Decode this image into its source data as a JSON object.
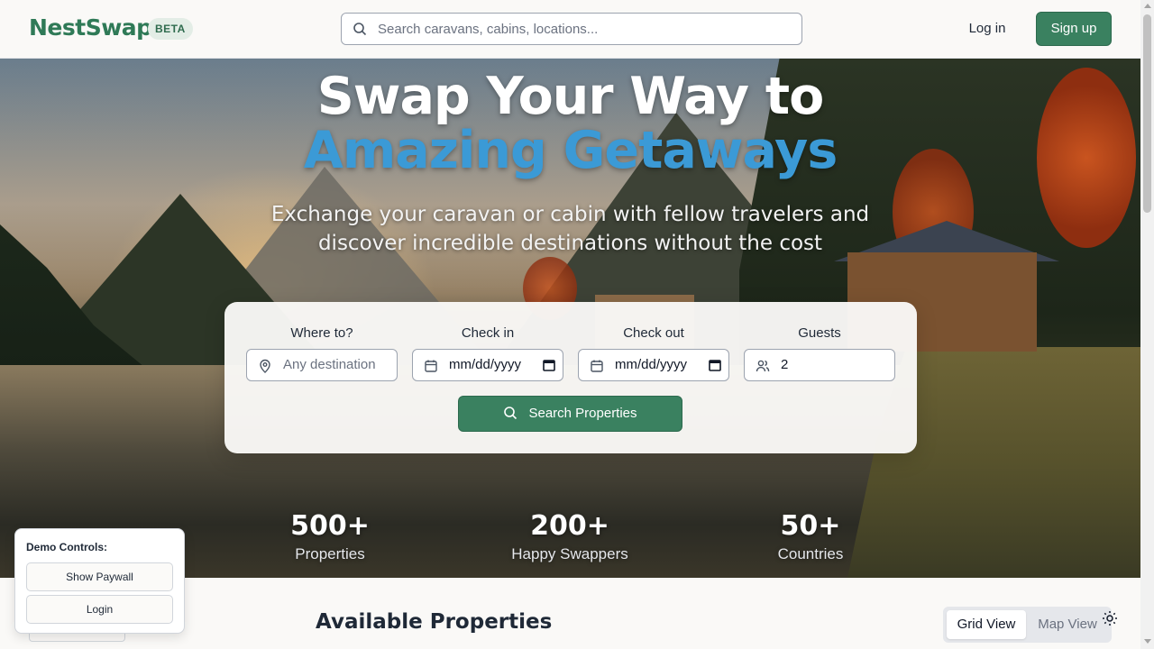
{
  "header": {
    "logo": "NestSwap",
    "badge": "BETA",
    "search_placeholder": "Search caravans, cabins, locations...",
    "login_label": "Log in",
    "signup_label": "Sign up"
  },
  "hero": {
    "title_line1": "Swap Your Way to",
    "title_line2": "Amazing Getaways",
    "subtitle": "Exchange your caravan or cabin with fellow travelers and discover incredible destinations without the cost",
    "search_card": {
      "where": {
        "label": "Where to?",
        "placeholder": "Any destination",
        "icon": "map-pin-icon"
      },
      "check_in": {
        "label": "Check in",
        "value": "mm/dd/yyyy",
        "icon": "calendar-icon"
      },
      "check_out": {
        "label": "Check out",
        "value": "mm/dd/yyyy",
        "icon": "calendar-icon"
      },
      "guests": {
        "label": "Guests",
        "value": "2",
        "icon": "users-icon"
      },
      "button_label": "Search Properties"
    },
    "stats": [
      {
        "value": "500+",
        "label": "Properties"
      },
      {
        "value": "200+",
        "label": "Happy Swappers"
      },
      {
        "value": "50+",
        "label": "Countries"
      }
    ]
  },
  "main": {
    "section_title": "Available Properties",
    "view_toggle": {
      "grid_label": "Grid View",
      "map_label": "Map View",
      "selected": "Grid View"
    }
  },
  "demo_controls": {
    "title": "Demo Controls:",
    "paywall_label": "Show Paywall",
    "login_label": "Login"
  },
  "colors": {
    "brand_green": "#3a8160",
    "accent_blue": "#3b9ad6",
    "background": "#faf9f7"
  }
}
